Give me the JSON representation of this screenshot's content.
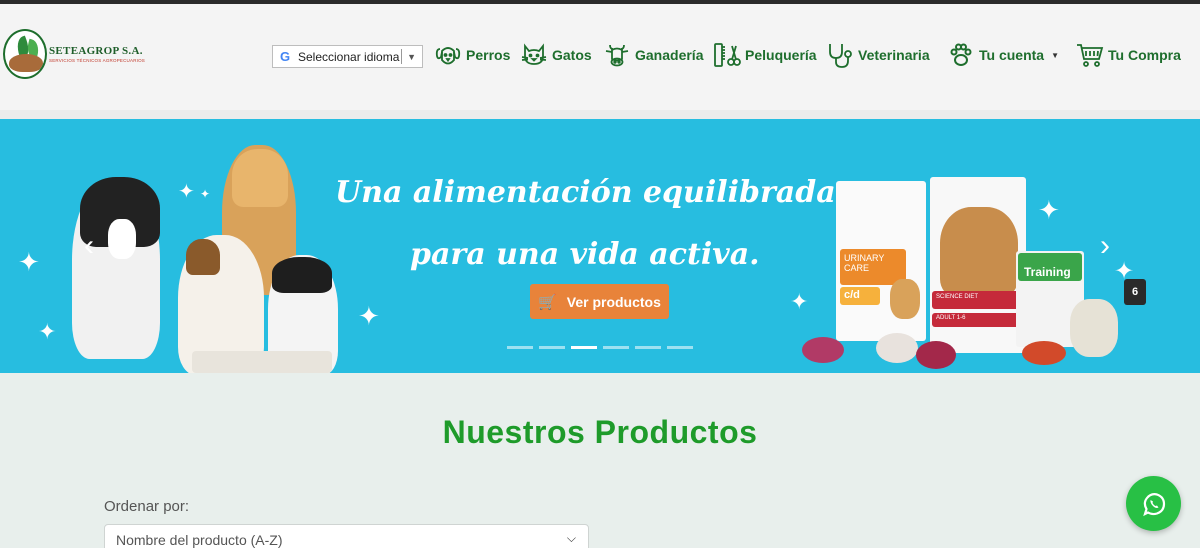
{
  "logo": {
    "name": "SETEAGROP S.A.",
    "subtitle": "SERVICIOS TÉCNICOS AGROPECUARIOS"
  },
  "language": {
    "label": "Seleccionar idioma",
    "icon": "google-g-icon"
  },
  "nav": [
    {
      "label": "Perros",
      "icon": "dog-icon"
    },
    {
      "label": "Gatos",
      "icon": "cat-icon"
    },
    {
      "label": "Ganadería",
      "icon": "cow-icon"
    },
    {
      "label": "Peluquería",
      "icon": "grooming-icon"
    },
    {
      "label": "Veterinaria",
      "icon": "stethoscope-icon"
    },
    {
      "label": "Tu cuenta",
      "icon": "paw-icon"
    },
    {
      "label": "Tu Compra",
      "icon": "cart-icon"
    }
  ],
  "banner": {
    "headline_line1": "Una alimentación equilibrada",
    "headline_line2": "para una vida activa.",
    "cta_label": "Ver productos",
    "slide_count_badge": "6",
    "dots_total": 6,
    "active_dot": 3,
    "products": {
      "bag1_label": "URINARY CARE",
      "bag1_code": "c/d",
      "bag2_label": "SCIENCE DIET",
      "bag2_sub": "ADULT 1-6",
      "bag3_label": "Training"
    },
    "colors": {
      "background": "#27bde0",
      "cta": "#e8833a"
    }
  },
  "products_section": {
    "title": "Nuestros Productos",
    "sort_label": "Ordenar por:",
    "sort_value": "Nombre del producto (A-Z)"
  },
  "colors": {
    "brand_green": "#1e6e2d",
    "title_green": "#1e9b2a",
    "whatsapp": "#28c045"
  }
}
